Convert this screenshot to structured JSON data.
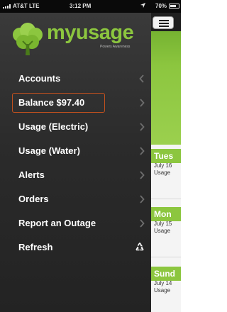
{
  "status_bar": {
    "carrier": "AT&T  LTE",
    "time": "3:12 PM",
    "battery": "70%",
    "battery_level": 0.7
  },
  "app": {
    "name": "myusage",
    "tagline": "Powers Awareness",
    "brand_color": "#8cc63f",
    "accent_outline_color": "#c0501e"
  },
  "menu": {
    "items": [
      {
        "label": "Accounts",
        "icon": "chevron-left-icon"
      },
      {
        "label": "Balance $97.40",
        "icon": "chevron-right-icon",
        "highlighted": true
      },
      {
        "label": "Usage (Electric)",
        "icon": "chevron-right-icon"
      },
      {
        "label": "Usage (Water)",
        "icon": "chevron-right-icon"
      },
      {
        "label": "Alerts",
        "icon": "chevron-right-icon"
      },
      {
        "label": "Orders",
        "icon": "chevron-right-icon"
      },
      {
        "label": "Report an Outage",
        "icon": "chevron-right-icon"
      },
      {
        "label": "Refresh",
        "icon": "recycle-icon"
      }
    ]
  },
  "content": {
    "menu_button_icon": "hamburger-icon",
    "days": [
      {
        "day": "Tues",
        "date": "July 16",
        "usage": "Usage"
      },
      {
        "day": "Mon",
        "date": "July 15",
        "usage": "Usage"
      },
      {
        "day": "Sund",
        "date": "July 14",
        "usage": "Usage"
      }
    ]
  }
}
